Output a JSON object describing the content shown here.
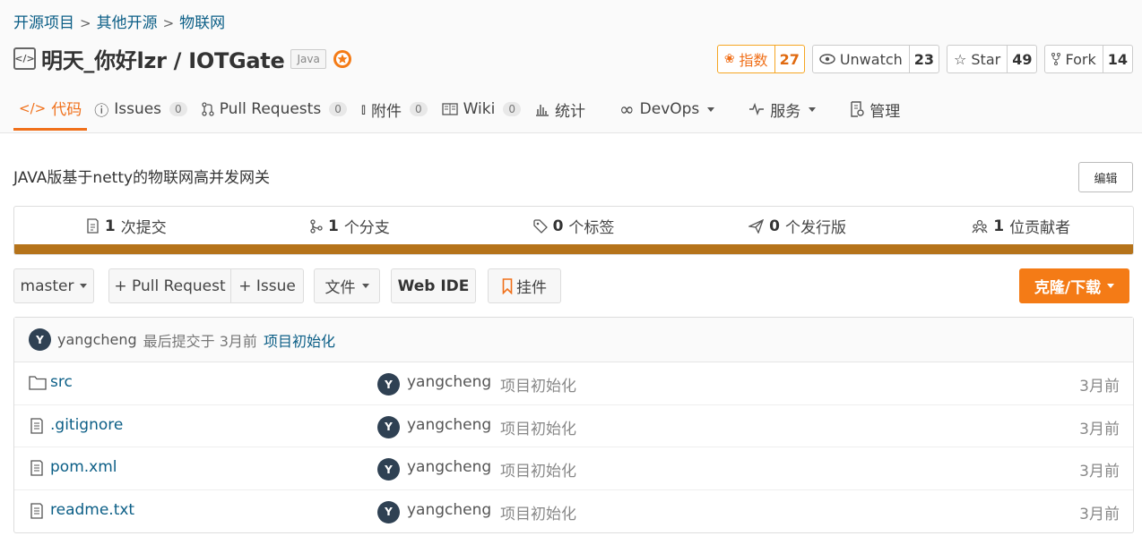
{
  "breadcrumb": {
    "items": [
      "开源项目",
      "其他开源",
      "物联网"
    ],
    "separator": ">"
  },
  "repo": {
    "icon": "code-repo-icon",
    "title": "明天_你好lzr / IOTGate",
    "language": "Java",
    "medal_icon": "gvp-medal-icon"
  },
  "actions": {
    "index": {
      "label": "指数",
      "count": "27"
    },
    "watch": {
      "label": "Unwatch",
      "count": "23"
    },
    "star": {
      "label": "Star",
      "count": "49"
    },
    "fork": {
      "label": "Fork",
      "count": "14"
    }
  },
  "tabs": [
    {
      "label": "代码",
      "icon": "code-icon"
    },
    {
      "label": "Issues",
      "badge": "0",
      "icon": "issue-icon"
    },
    {
      "label": "Pull Requests",
      "badge": "0",
      "icon": "pull-request-icon"
    },
    {
      "label": "附件",
      "badge": "0",
      "icon": "paperclip-icon"
    },
    {
      "label": "Wiki",
      "badge": "0",
      "icon": "book-icon"
    },
    {
      "label": "统计",
      "icon": "bar-chart-icon"
    },
    {
      "label": "DevOps",
      "icon": "infinity-icon"
    },
    {
      "label": "服务",
      "icon": "pulse-icon"
    },
    {
      "label": "管理",
      "icon": "settings-doc-icon"
    }
  ],
  "description": "JAVA版基于netty的物联网高并发网关",
  "edit_label": "编辑",
  "stats": [
    {
      "count": "1",
      "label": "次提交",
      "icon": "commit-icon"
    },
    {
      "count": "1",
      "label": "个分支",
      "icon": "branch-icon"
    },
    {
      "count": "0",
      "label": "个标签",
      "icon": "tag-icon"
    },
    {
      "count": "0",
      "label": "个发行版",
      "icon": "release-icon"
    },
    {
      "count": "1",
      "label": "位贡献者",
      "icon": "contributors-icon"
    }
  ],
  "language_bar_color": "#b5731a",
  "toolbar": {
    "branch": "master",
    "pull_request": "+ Pull Request",
    "issue": "+ Issue",
    "file": "文件",
    "web_ide": "Web IDE",
    "bookmark": "挂件",
    "clone": "克隆/下载"
  },
  "last_commit": {
    "avatar": "Y",
    "author": "yangcheng",
    "text": "最后提交于 3月前",
    "message": "项目初始化"
  },
  "files": [
    {
      "name": "src",
      "type": "folder",
      "avatar": "Y",
      "author": "yangcheng",
      "message": "项目初始化",
      "time": "3月前"
    },
    {
      "name": ".gitignore",
      "type": "file",
      "avatar": "Y",
      "author": "yangcheng",
      "message": "项目初始化",
      "time": "3月前"
    },
    {
      "name": "pom.xml",
      "type": "file",
      "avatar": "Y",
      "author": "yangcheng",
      "message": "项目初始化",
      "time": "3月前"
    },
    {
      "name": "readme.txt",
      "type": "file",
      "avatar": "Y",
      "author": "yangcheng",
      "message": "项目初始化",
      "time": "3月前"
    }
  ],
  "colors": {
    "accent": "#f0701a",
    "link": "#0b5e86",
    "clone_button": "#f47b16"
  }
}
